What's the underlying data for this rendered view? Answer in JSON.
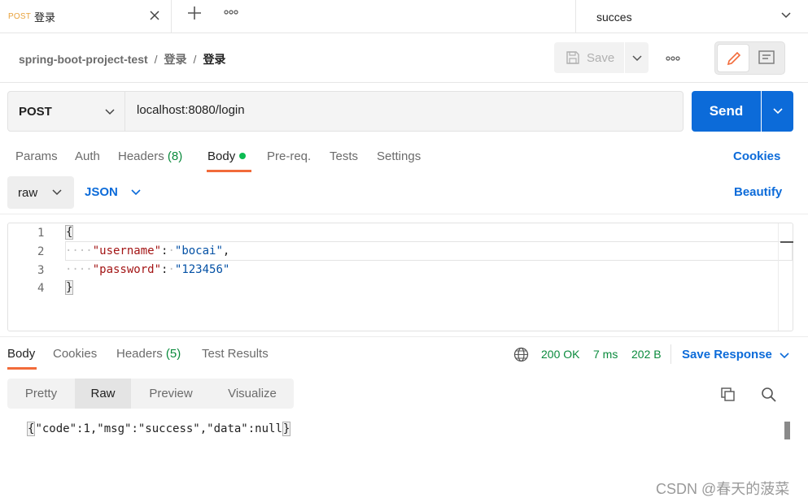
{
  "tab": {
    "method": "POST",
    "title": "登录"
  },
  "environment": {
    "selected": "succes"
  },
  "breadcrumb": {
    "collection": "spring-boot-project-test",
    "folder": "登录",
    "request": "登录",
    "separator": "/"
  },
  "toolbar": {
    "save_label": "Save"
  },
  "request": {
    "method": "POST",
    "url": "localhost:8080/login",
    "send_label": "Send"
  },
  "request_tabs": {
    "params": "Params",
    "auth": "Auth",
    "headers": "Headers",
    "headers_count": "(8)",
    "body": "Body",
    "prereq": "Pre-req.",
    "tests": "Tests",
    "settings": "Settings",
    "cookies": "Cookies"
  },
  "body_options": {
    "mode": "raw",
    "language": "JSON",
    "beautify": "Beautify"
  },
  "editor": {
    "line_numbers": [
      "1",
      "2",
      "3",
      "4"
    ],
    "open_brace": "{",
    "close_brace": "}",
    "line2_key": "\"username\"",
    "line2_value": "\"bocai\"",
    "line3_key": "\"password\"",
    "line3_value": "\"123456\"",
    "colon": ":",
    "comma": ","
  },
  "response_tabs": {
    "body": "Body",
    "cookies": "Cookies",
    "headers": "Headers",
    "headers_count": "(5)",
    "test_results": "Test Results"
  },
  "response_meta": {
    "status": "200 OK",
    "time": "7 ms",
    "size": "202 B",
    "save_response": "Save Response"
  },
  "view_modes": {
    "pretty": "Pretty",
    "raw": "Raw",
    "preview": "Preview",
    "visualize": "Visualize"
  },
  "response_body": {
    "open": "{",
    "content": "\"code\":1,\"msg\":\"success\",\"data\":null",
    "close": "}"
  },
  "watermark": "CSDN @春天的菠菜",
  "colors": {
    "accent": "#0c6bd9",
    "success": "#0a8a3c",
    "tab_underline": "#f26b3a",
    "method_post": "#e8a23c"
  }
}
